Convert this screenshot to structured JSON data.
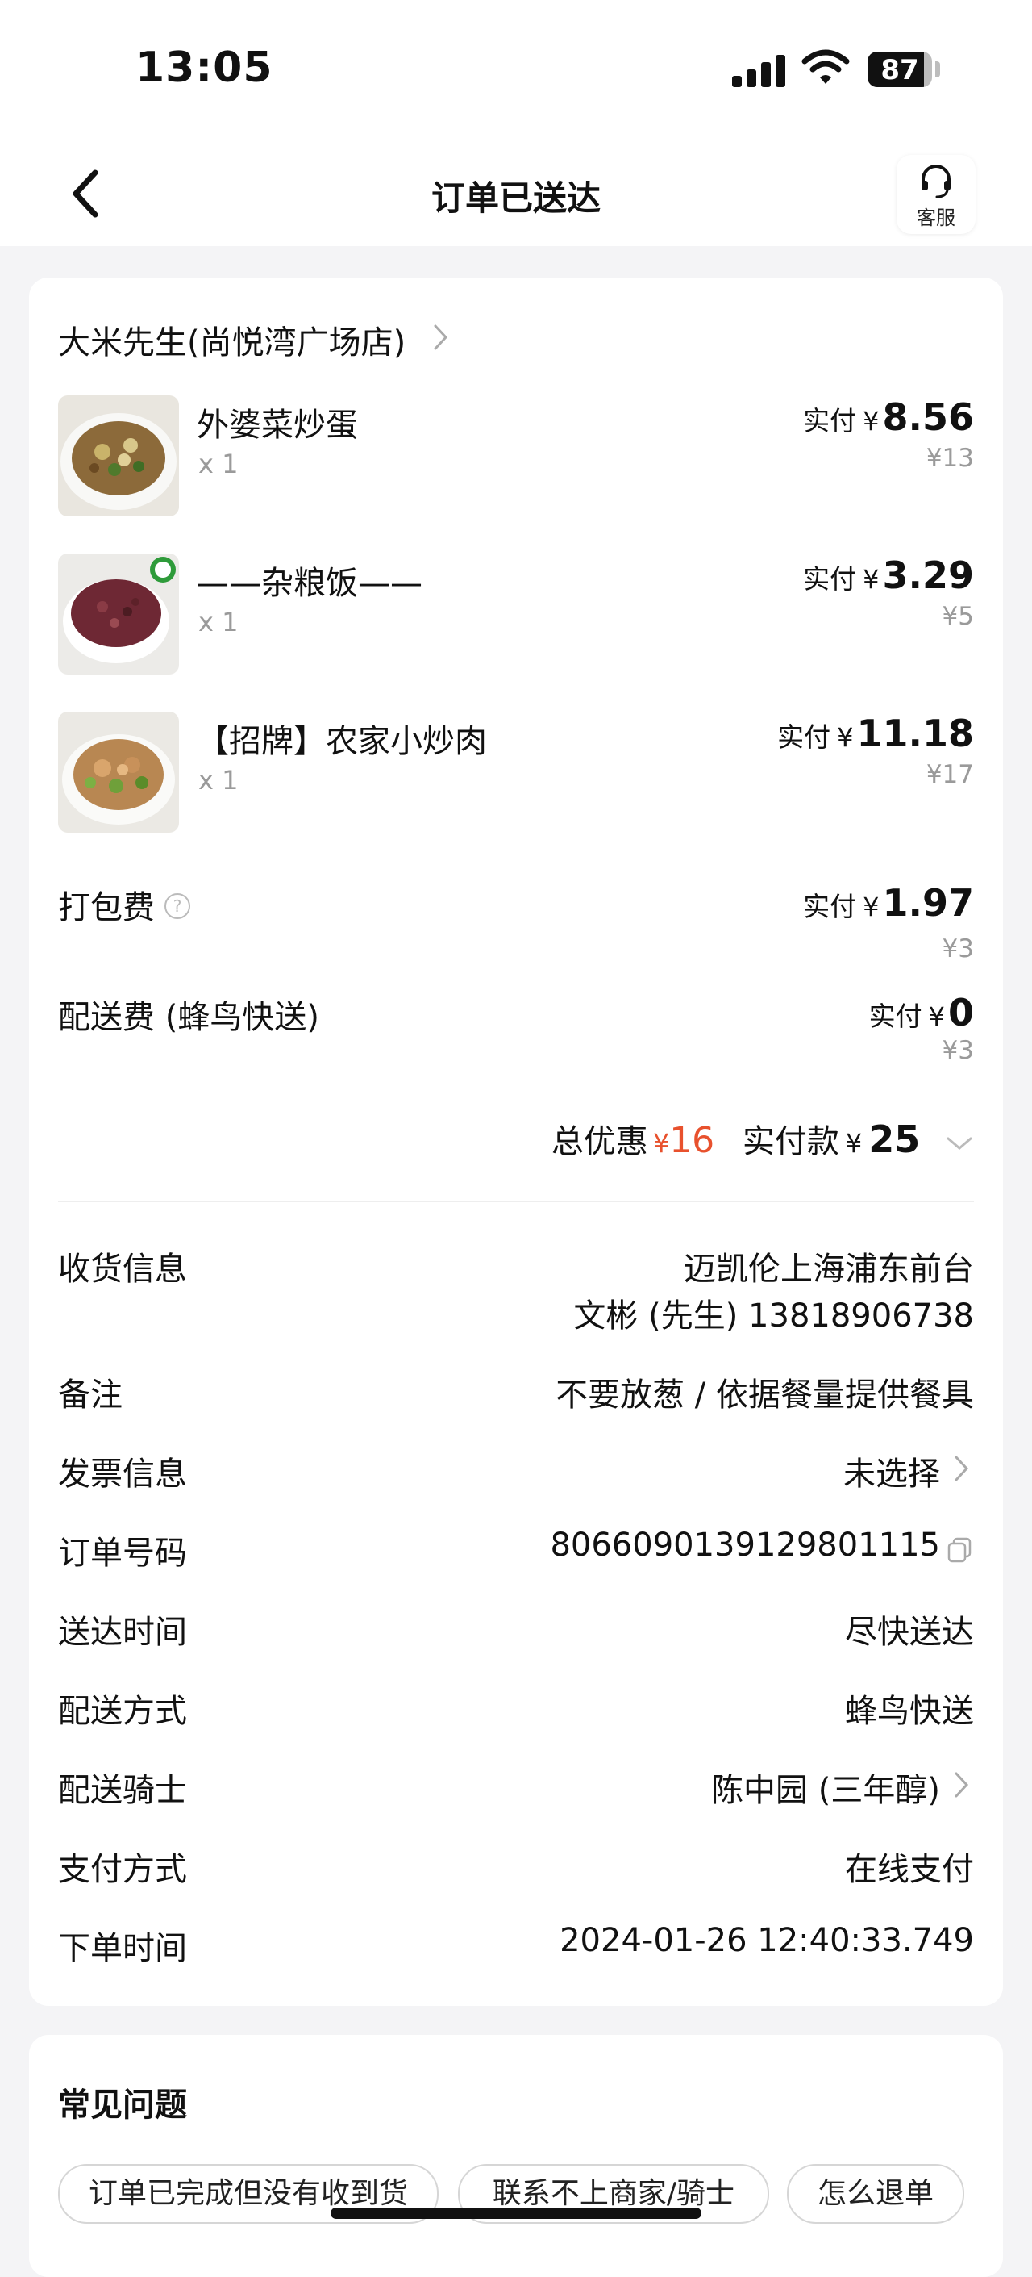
{
  "status": {
    "time": "13:05",
    "battery": "87",
    "battery_level": 0.87
  },
  "nav": {
    "title": "订单已送达",
    "service_label": "客服"
  },
  "order": {
    "store": "大米先生(尚悦湾广场店)",
    "paid_label": "实付",
    "currency": "¥",
    "items": [
      {
        "name": "外婆菜炒蛋",
        "qty": "x 1",
        "paid": "8.56",
        "original": "¥13"
      },
      {
        "name": "——杂粮饭——",
        "qty": "x 1",
        "paid": "3.29",
        "original": "¥5"
      },
      {
        "name": "【招牌】农家小炒肉",
        "qty": "x 1",
        "paid": "11.18",
        "original": "¥17"
      }
    ],
    "fees": [
      {
        "name": "打包费",
        "help": "?",
        "paid": "1.97",
        "original": "¥3"
      },
      {
        "name": "配送费 (蜂鸟快送)",
        "paid": "0",
        "original": "¥3"
      }
    ],
    "summary": {
      "discount_label": "总优惠",
      "discount": "16",
      "total_label": "实付款",
      "total": "25"
    }
  },
  "info": {
    "receiver_label": "收货信息",
    "receiver_address": "迈凯伦上海浦东前台",
    "receiver_contact": "文彬 (先生) 13818906738",
    "note_label": "备注",
    "note": "不要放葱 / 依据餐量提供餐具",
    "invoice_label": "发票信息",
    "invoice": "未选择",
    "order_no_label": "订单号码",
    "order_no": "8066090139129801115",
    "delivery_time_label": "送达时间",
    "delivery_time": "尽快送达",
    "delivery_method_label": "配送方式",
    "delivery_method": "蜂鸟快送",
    "rider_label": "配送骑士",
    "rider": "陈中园 (三年醇)",
    "payment_label": "支付方式",
    "payment": "在线支付",
    "order_time_label": "下单时间",
    "order_time": "2024-01-26 12:40:33.749"
  },
  "faq": {
    "title": "常见问题",
    "items": [
      "订单已完成但没有收到货",
      "联系不上商家/骑士",
      "怎么退单"
    ]
  }
}
